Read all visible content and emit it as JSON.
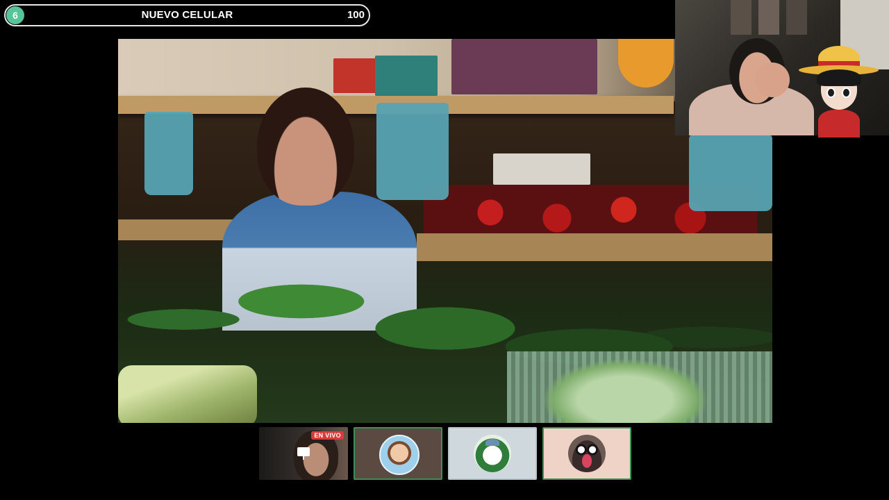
{
  "goal_bar": {
    "level": "6",
    "title": "NUEVO CELULAR",
    "count": "100"
  },
  "participants": {
    "screen_share": {
      "badge": "EN VIVO",
      "icon": "screen-share-icon"
    },
    "tiles": [
      {
        "id": "participant-2",
        "active": true
      },
      {
        "id": "participant-3",
        "active": false
      },
      {
        "id": "participant-4",
        "active": true
      }
    ]
  },
  "colors": {
    "level_badge": "#58c49a",
    "live_badge": "#d93a3a",
    "active_border": "#3e8f58"
  }
}
